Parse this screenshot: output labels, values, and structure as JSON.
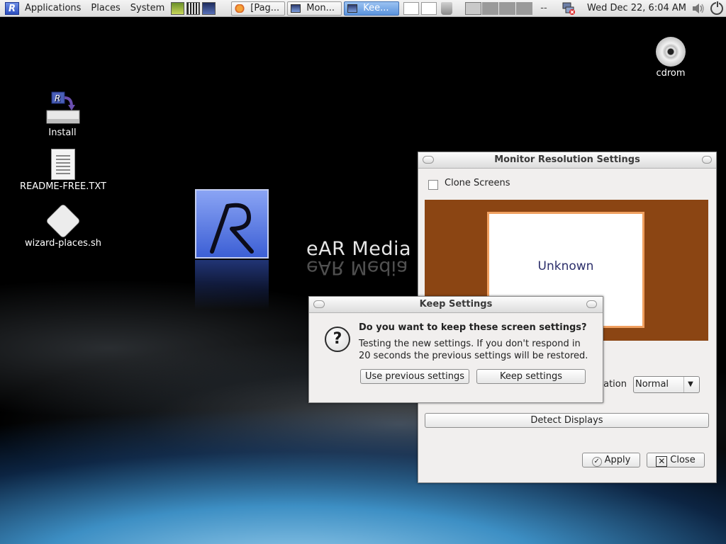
{
  "panel": {
    "menus": [
      "Applications",
      "Places",
      "System"
    ],
    "tasks": [
      {
        "label": "[Pag...",
        "active": false
      },
      {
        "label": "Mon...",
        "active": false
      },
      {
        "label": "Kee...",
        "active": true
      }
    ],
    "pager_extra": "--",
    "clock": "Wed Dec 22,  6:04 AM"
  },
  "desktop": {
    "icons": [
      {
        "label": "Install"
      },
      {
        "label": "README-FREE.TXT"
      },
      {
        "label": "wizard-places.sh"
      },
      {
        "label": "cdrom"
      }
    ],
    "brand_text": "eAR Media",
    "logo_letter": "R"
  },
  "monitor_window": {
    "title": "Monitor Resolution Settings",
    "clone_label": "Clone Screens",
    "monitor_name": "Unknown",
    "rotation_label": "tation",
    "rotation_value": "Normal",
    "detect_label": "Detect Displays",
    "apply_label": "Apply",
    "close_label": "Close"
  },
  "keep_dialog": {
    "title": "Keep Settings",
    "question": "Do you want to keep these screen settings?",
    "message": "Testing the new settings. If you don't respond in 20 seconds the previous settings will be restored.",
    "use_previous_label": "Use previous settings",
    "keep_label": "Keep settings"
  }
}
